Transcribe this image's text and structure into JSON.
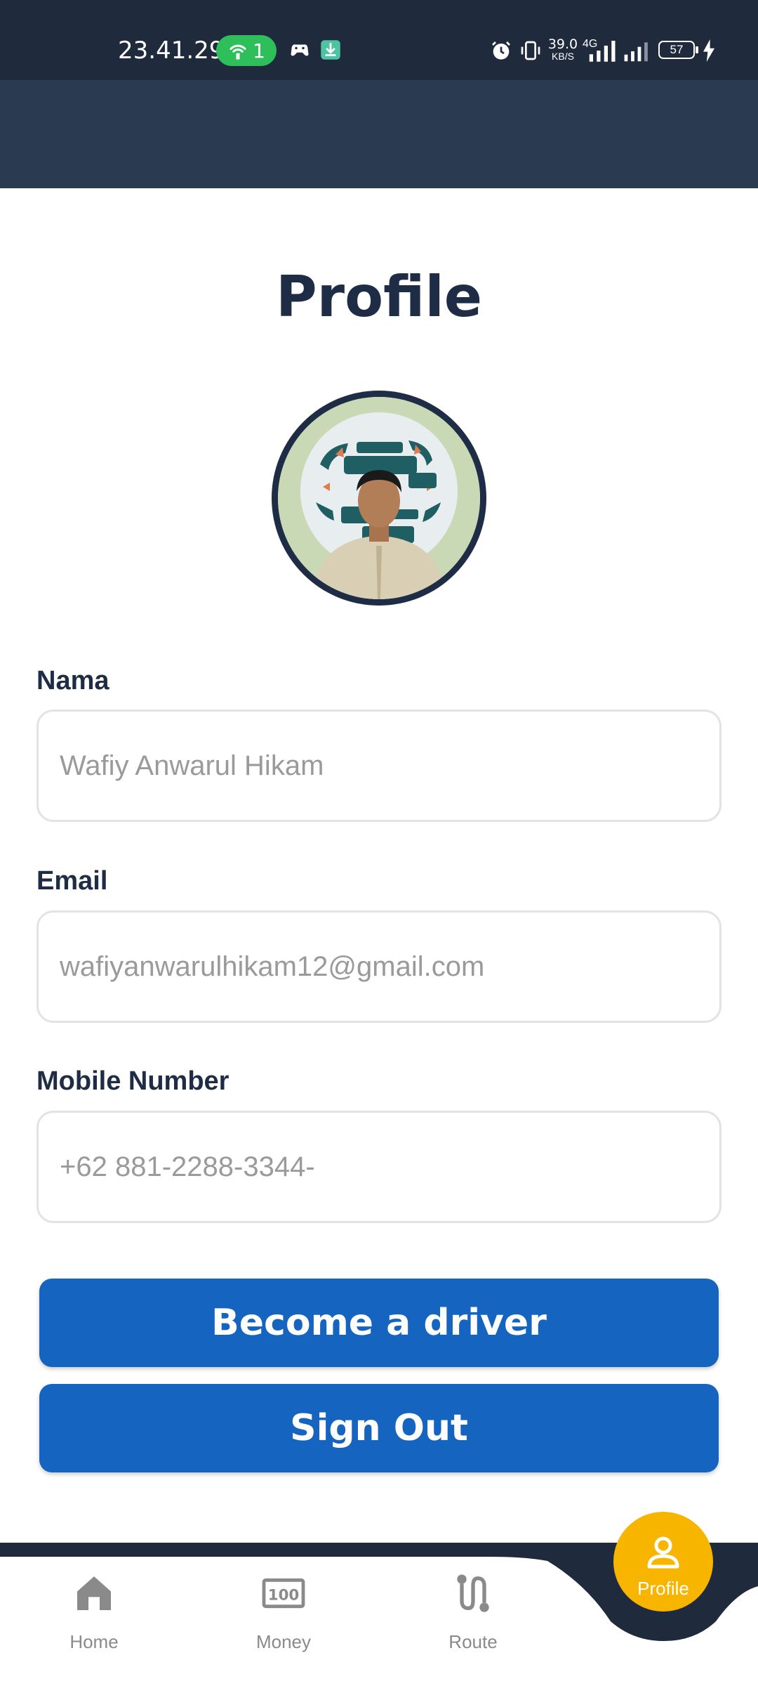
{
  "status_bar": {
    "time": "23.41.29",
    "hotspot_count": "1",
    "speed_value": "39.0",
    "speed_unit": "KB/S",
    "network": "4G",
    "battery": "57"
  },
  "page": {
    "title": "Profile"
  },
  "form": {
    "name_label": "Nama",
    "name_placeholder": "Wafiy Anwarul Hikam",
    "email_label": "Email",
    "email_placeholder": "wafiyanwarulhikam12@gmail.com",
    "mobile_label": "Mobile Number",
    "mobile_placeholder": "+62 881-2288-3344-"
  },
  "buttons": {
    "become_driver": "Become a driver",
    "sign_out": "Sign Out"
  },
  "bottom_nav": {
    "items": [
      {
        "label": "Home",
        "icon": "home-icon"
      },
      {
        "label": "Money",
        "icon": "money-icon"
      },
      {
        "label": "Route",
        "icon": "route-icon"
      },
      {
        "label": "Profile",
        "icon": "person-icon",
        "active": true
      }
    ]
  },
  "colors": {
    "primary": "#1565c0",
    "dark": "#1e2d45",
    "accent": "#f7b500"
  }
}
